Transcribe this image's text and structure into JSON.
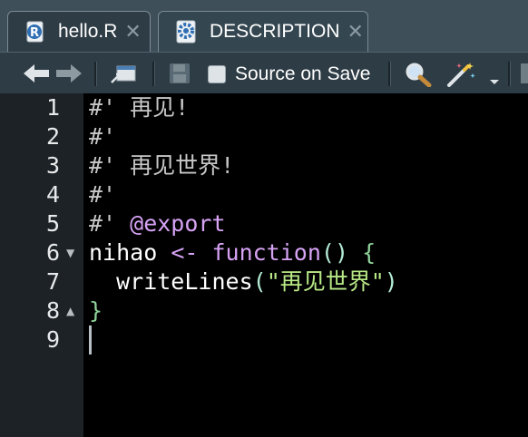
{
  "tabs": [
    {
      "label": "hello.R",
      "close": "✕",
      "icon": "r-file-icon"
    },
    {
      "label": "DESCRIPTION",
      "close": "✕",
      "icon": "gear-icon"
    }
  ],
  "toolbar": {
    "source_on_save_label": "Source on Save",
    "source_on_save_checked": false,
    "icons": [
      "back-arrow-icon",
      "forward-arrow-icon",
      "show-in-window-icon",
      "save-icon",
      "search-icon",
      "magic-wand-icon",
      "chevron-down-icon"
    ]
  },
  "editor": {
    "line_numbers": [
      "1",
      "2",
      "3",
      "4",
      "5",
      "6",
      "7",
      "8",
      "9"
    ],
    "lines": [
      [
        {
          "t": "#' 再见!",
          "c": "cm"
        }
      ],
      [
        {
          "t": "#'",
          "c": "cm"
        }
      ],
      [
        {
          "t": "#' 再见世界!",
          "c": "cm"
        }
      ],
      [
        {
          "t": "#'",
          "c": "cm"
        }
      ],
      [
        {
          "t": "#' ",
          "c": "cm"
        },
        {
          "t": "@export",
          "c": "tag"
        }
      ],
      [
        {
          "t": "nihao ",
          "c": "plain"
        },
        {
          "t": "<- ",
          "c": "kw"
        },
        {
          "t": "function",
          "c": "kw"
        },
        {
          "t": "()",
          "c": "paren"
        },
        {
          "t": " ",
          "c": "plain"
        },
        {
          "t": "{",
          "c": "brace"
        }
      ],
      [
        {
          "t": "  writeLines",
          "c": "plain"
        },
        {
          "t": "(",
          "c": "paren"
        },
        {
          "t": "\"再见世界\"",
          "c": "str"
        },
        {
          "t": ")",
          "c": "paren"
        }
      ],
      [
        {
          "t": "}",
          "c": "brace"
        }
      ],
      [
        {
          "t": "",
          "c": "plain"
        }
      ]
    ],
    "fold_markers": {
      "6": "▼",
      "8": "▲"
    }
  },
  "colors": {
    "tab_bg": "#3e4f5a",
    "toolbar_bg": "#2e3c45",
    "editor_bg": "#000000",
    "gutter_bg": "#1c2226",
    "keyword": "#d7a3f5",
    "string": "#b8e986",
    "comment": "#c7c7c7"
  }
}
